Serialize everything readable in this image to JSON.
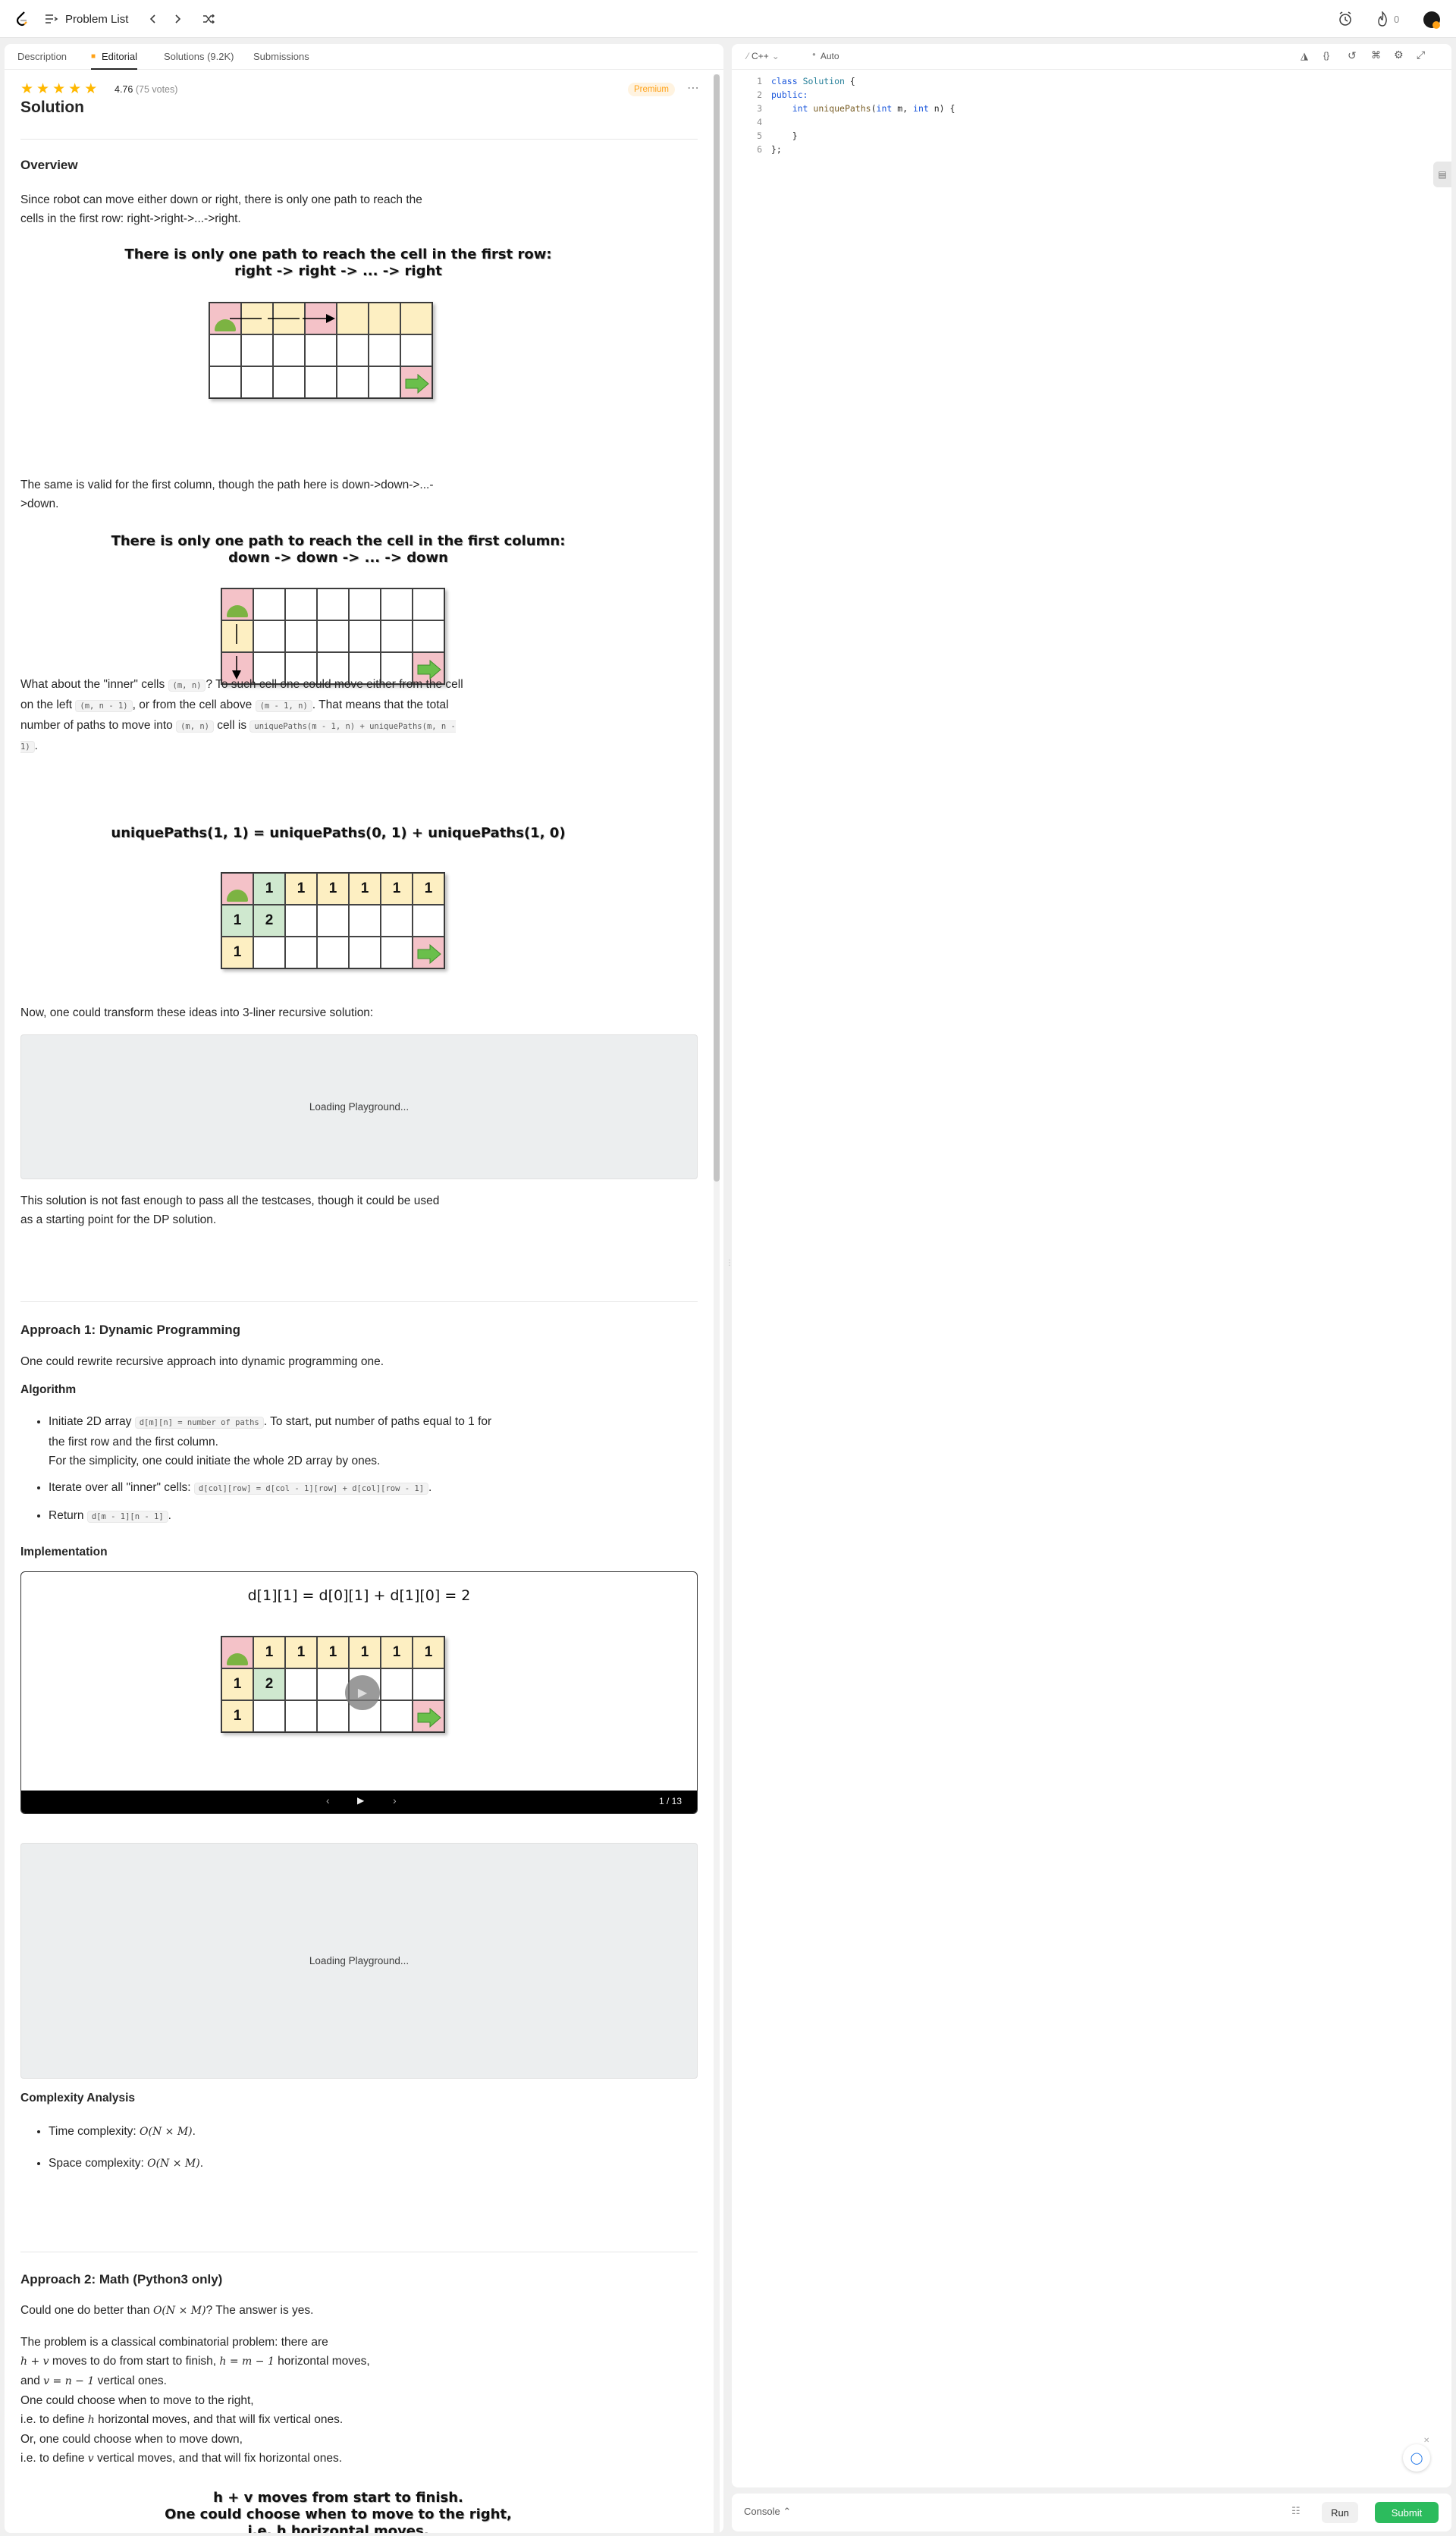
{
  "header": {
    "problem_list": "Problem List",
    "streak": "0"
  },
  "tabs": [
    "Description",
    "Editorial",
    "Solutions (9.2K)",
    "Submissions"
  ],
  "rating": {
    "value": "4.76",
    "votes": "(75 votes)",
    "badge": "Premium"
  },
  "solution_title": "Solution",
  "overview": {
    "heading": "Overview",
    "p1": "Since robot can move either down or right, there is only one path to reach the cells in the first row: right->right->...->right.",
    "fig1_title": "There is only one path to reach the cell in the first row:\nright -> right -> ... -> right",
    "p2": "The same is valid for the first column, though the path here is down->down->...->down.",
    "fig2_title": "There is only one path to reach the cell in the first column:\ndown -> down -> ... -> down",
    "p3a": "What about the \"inner\" cells ",
    "c_mn": "(m, n)",
    "p3b": "? To such cell one could move either from the cell on the left ",
    "c_left": "(m, n - 1)",
    "p3c": ", or from the cell above ",
    "c_above": "(m - 1, n)",
    "p3d": ". That means that the total number of paths to move into ",
    "c_mn2": "(m, n)",
    "p3e": " cell is ",
    "c_formula": "uniquePaths(m - 1, n) + uniquePaths(m, n - 1)",
    "p3f": ".",
    "fig3_title": "uniquePaths(1, 1) = uniquePaths(0, 1) + uniquePaths(1, 0)",
    "p4": "Now, one could transform these ideas into 3-liner recursive solution:",
    "loading": "Loading Playground...",
    "p5": "This solution is not fast enough to pass all the testcases, though it could be used as a starting point for the DP solution."
  },
  "approach1": {
    "heading": "Approach 1: Dynamic Programming",
    "p1": "One could rewrite recursive approach into dynamic programming one.",
    "algorithm": "Algorithm",
    "b1a": "Initiate 2D array ",
    "b1code": "d[m][n] = number of paths",
    "b1b": ". To start, put number of paths equal to 1 for the first row and the first column.",
    "b1c": "For the simplicity, one could initiate the whole 2D array by ones.",
    "b2a": "Iterate over all \"inner\" cells: ",
    "b2code": "d[col][row] = d[col - 1][row] + d[col][row - 1]",
    "b2b": ".",
    "b3a": "Return ",
    "b3code": "d[m - 1][n - 1]",
    "b3b": ".",
    "implementation": "Implementation",
    "slide_title": "d[1][1] = d[0][1] + d[1][0] = 2",
    "slide_counter": "1 / 13",
    "loading": "Loading Playground...",
    "complexity": "Complexity Analysis",
    "time": "Time complexity: ",
    "time_val": "O(N × M)",
    "space": "Space complexity: ",
    "space_val": "O(N × M)",
    "period": "."
  },
  "approach2": {
    "heading": "Approach 2: Math (Python3 only)",
    "q1": "Could one do better than ",
    "q_math": "O(N × M)",
    "q2": "? The answer is yes.",
    "l1": "The problem is a classical combinatorial problem: there are",
    "l2a": "h + v",
    "l2b": " moves to do from start to finish, ",
    "l2c": "h = m − 1",
    "l2d": " horizontal moves,",
    "l3a": "and ",
    "l3b": "v = n − 1",
    "l3c": " vertical ones.",
    "l4": "One could choose when to move to the right,",
    "l5a": "i.e. to define ",
    "l5b": "h",
    "l5c": " horizontal moves, and that will fix vertical ones.",
    "l6": "Or, one could choose when to move down,",
    "l7a": "i.e. to define ",
    "l7b": "v",
    "l7c": " vertical moves, and that will fix horizontal ones.",
    "fig_title": "h + v moves from start to finish.\nOne could choose when to move to the right,\ni.e. h horizontal moves."
  },
  "editor": {
    "language": "C++",
    "mode": "Auto",
    "lines": [
      "1",
      "2",
      "3",
      "4",
      "5",
      "6"
    ],
    "code_class_kw": "class",
    "code_class_name": "Solution",
    "code_brace": " {",
    "code_public": "public:",
    "code_int": "int",
    "code_fn": "uniquePaths",
    "code_params_open": "(",
    "code_int2": "int",
    "code_m": " m, ",
    "code_int3": "int",
    "code_n": " n) {",
    "code_close_fn": "}",
    "code_close_class": "};"
  },
  "console": {
    "label": "Console",
    "run": "Run",
    "submit": "Submit"
  },
  "grid_numbers": {
    "one": "1",
    "two": "2"
  }
}
